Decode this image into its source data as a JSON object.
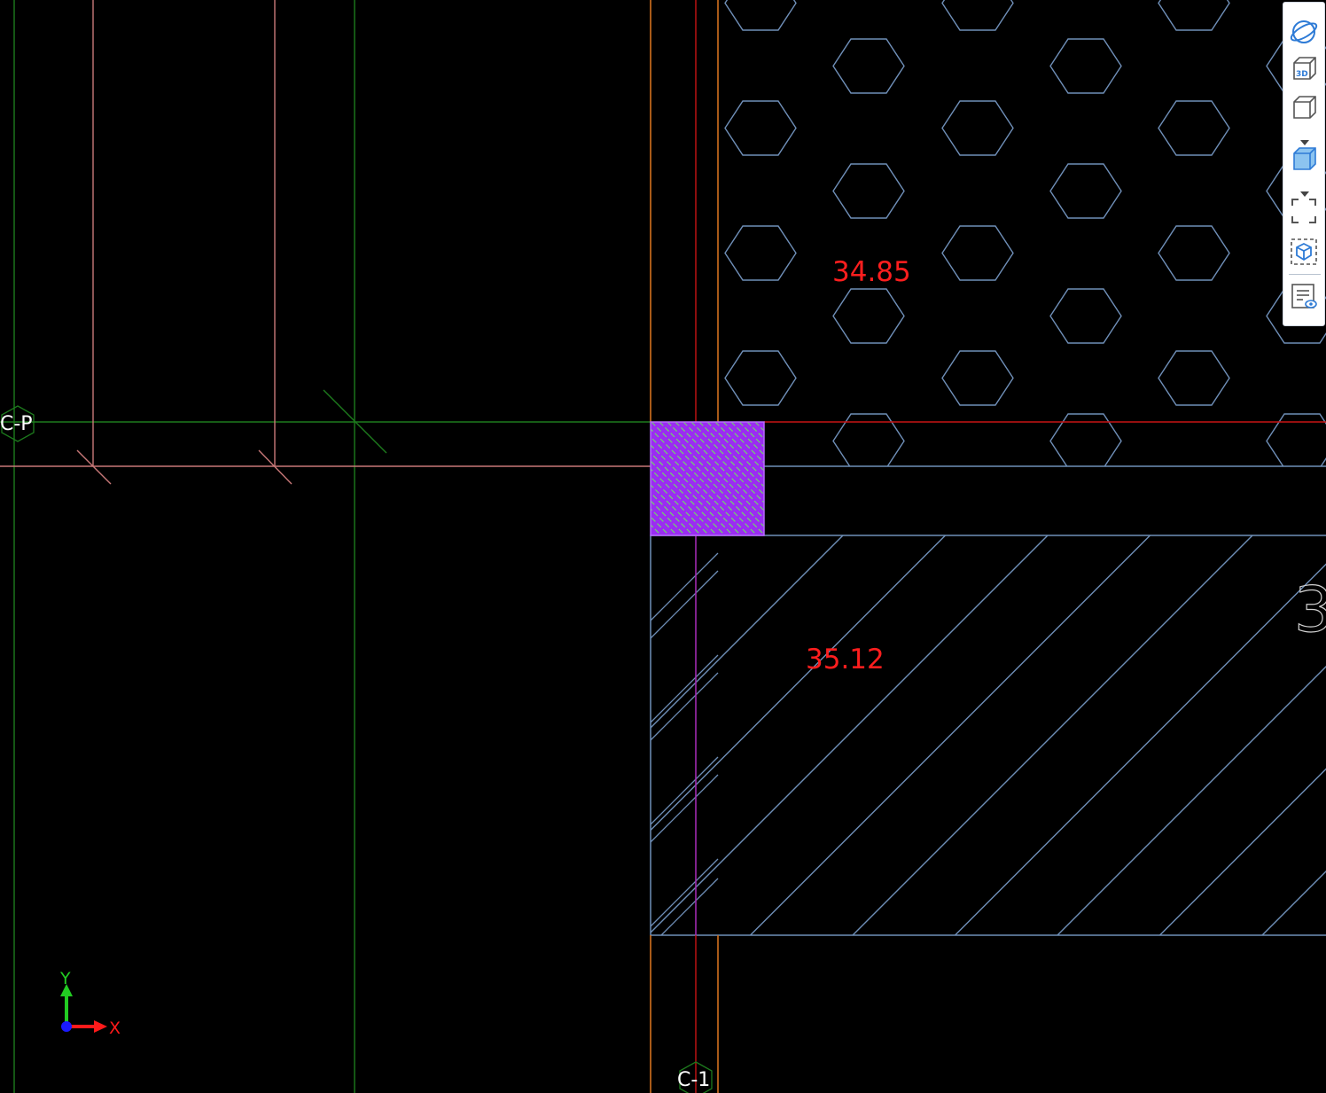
{
  "grid_labels": {
    "row_c_p": "C-P",
    "column_c_1": "C-1"
  },
  "region_values": {
    "upper_region": "34.85",
    "lower_region": "35.12"
  },
  "edge_label_partial": "3",
  "axis_labels": {
    "x": "X",
    "y": "Y"
  },
  "toolbar": {
    "buttons": [
      {
        "name": "orbit-button",
        "icon": "orbit-icon"
      },
      {
        "name": "view-3d-button",
        "icon": "cube-3d-icon",
        "badge": "3D"
      },
      {
        "name": "view-cube-outline-button",
        "icon": "cube-outline-icon",
        "has_dropdown": true
      },
      {
        "name": "view-cube-shaded-button",
        "icon": "cube-shaded-icon",
        "has_dropdown": true
      },
      {
        "name": "zoom-extents-button",
        "icon": "zoom-extents-icon"
      },
      {
        "name": "zoom-selected-button",
        "icon": "zoom-selected-icon"
      },
      {
        "name": "properties-view-button",
        "icon": "list-eye-icon"
      }
    ]
  },
  "colors": {
    "background": "#000000",
    "hatch_outline": "#6f8fb8",
    "dimension_text": "#ff1e1e",
    "grid_green": "#1d7a1d",
    "grid_red": "#c81414",
    "wall_pink": "#c87878",
    "column_orange": "#d2711e",
    "selected_fill": "#9b2cf2",
    "toolbar_icon": "#2e7bd6"
  }
}
